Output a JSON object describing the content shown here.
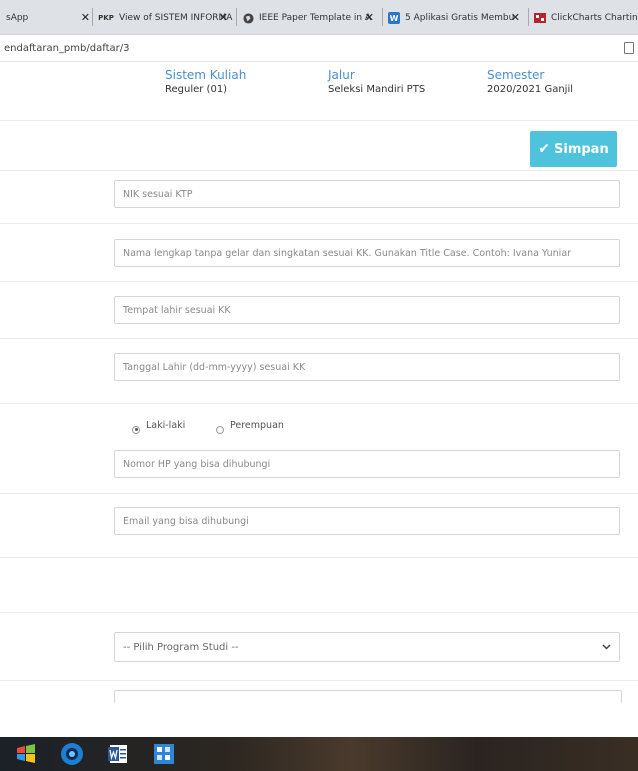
{
  "browser": {
    "tabs": [
      {
        "title": "sApp",
        "favicon": "whatsapp-icon"
      },
      {
        "title": "View of SISTEM INFORMA",
        "favicon": "pkp-icon",
        "favicon_text": "PKP"
      },
      {
        "title": "IEEE Paper Template in A",
        "favicon": "globe-icon"
      },
      {
        "title": "5 Aplikasi Gratis Membu",
        "favicon": "w-icon",
        "favicon_text": "W"
      },
      {
        "title": "ClickCharts Charting, M",
        "favicon": "clickcharts-icon"
      }
    ],
    "close_glyph": "✕",
    "url": "endaftaran_pmb/daftar/3"
  },
  "header": {
    "sistem_kuliah": {
      "label": "Sistem Kuliah",
      "value": "Reguler (01)"
    },
    "jalur": {
      "label": "Jalur",
      "value": "Seleksi Mandiri PTS"
    },
    "semester": {
      "label": "Semester",
      "value": "2020/2021 Ganjil"
    }
  },
  "actions": {
    "save_icon": "✔",
    "save_label": "Simpan"
  },
  "form": {
    "nik_placeholder": "NIK sesuai KTP",
    "nama_placeholder": "Nama lengkap tanpa gelar dan singkatan sesuai KK. Gunakan Title Case. Contoh: Ivana Yuniar",
    "tempat_lahir_placeholder": "Tempat lahir sesuai KK",
    "tanggal_lahir_placeholder": "Tanggal Lahir (dd-mm-yyyy) sesuai KK",
    "gender_options": [
      {
        "label": "Laki-laki",
        "selected": true
      },
      {
        "label": "Perempuan",
        "selected": false
      }
    ],
    "hp_placeholder": "Nomor HP yang bisa dihubungi",
    "email_placeholder": "Email yang bisa dihubungi",
    "prodi_select": "-- Pilih Program Studi --"
  },
  "taskbar": {
    "apps": [
      "windows-start-icon",
      "browser-icon",
      "word-icon",
      "app-grid-icon"
    ]
  },
  "colors": {
    "accent_blue": "#4a8fcf",
    "save_button": "#4fc3db"
  }
}
